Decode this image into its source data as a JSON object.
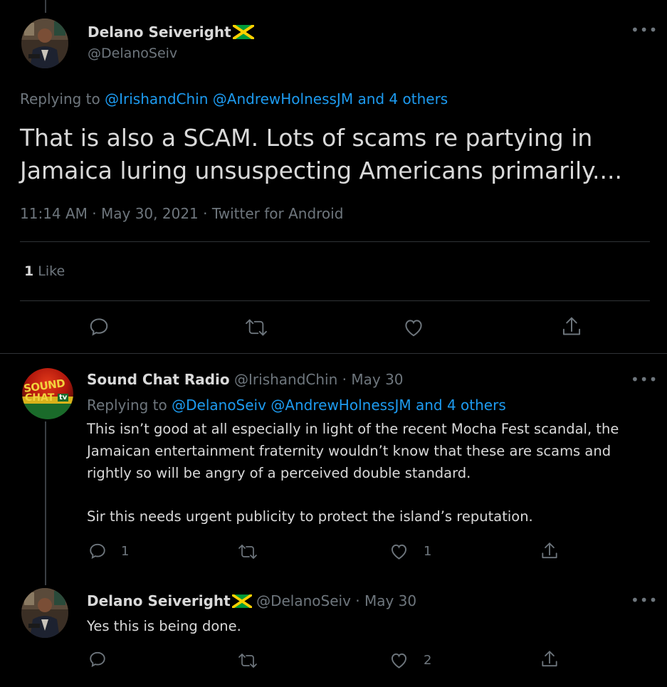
{
  "main_tweet": {
    "name": "Delano Seiveright",
    "handle": "@DelanoSeiv",
    "replying_prefix": "Replying to",
    "replying_to": [
      "@IrishandChin",
      "@AndrewHolnessJM"
    ],
    "replying_others": "and 4 others",
    "text_line1": "That is also a SCAM. Lots of scams re partying in",
    "text_line2": "Jamaica luring unsuspecting Americans primarily....",
    "meta": "11:14 AM · May 30, 2021 · Twitter for Android",
    "likes_count": "1",
    "likes_label": "Like"
  },
  "reply1": {
    "name": "Sound Chat Radio",
    "handle": "@IrishandChin",
    "date": "· May 30",
    "replying_prefix": "Replying to",
    "replying_to": [
      "@DelanoSeiv",
      "@AndrewHolnessJM"
    ],
    "replying_others": "and 4 others",
    "text_line1": "This isn’t good at all especially in light of the recent Mocha Fest scandal, the",
    "text_line2": "Jamaican entertainment fraternity wouldn’t know that these are scams and",
    "text_line3": "rightly so will be angry of a perceived double standard.",
    "text_line4": "Sir this needs urgent publicity to protect the island’s reputation.",
    "reply_count": "1",
    "like_count": "1",
    "avatar_text1": "SOUND",
    "avatar_text2": "CHAT",
    "avatar_text3": "tv"
  },
  "reply2": {
    "name": "Delano Seiveright",
    "handle": "@DelanoSeiv",
    "date": "· May 30",
    "text": "Yes this is being done.",
    "like_count": "2"
  },
  "icons": {
    "reply": "reply-icon",
    "retweet": "retweet-icon",
    "like": "heart-icon",
    "share": "share-icon",
    "more": "more-icon",
    "flag": "jamaica-flag-icon"
  },
  "colors": {
    "background": "#000000",
    "link": "#1d9bf0",
    "muted": "#6e767d",
    "text": "#d9d9d9"
  }
}
